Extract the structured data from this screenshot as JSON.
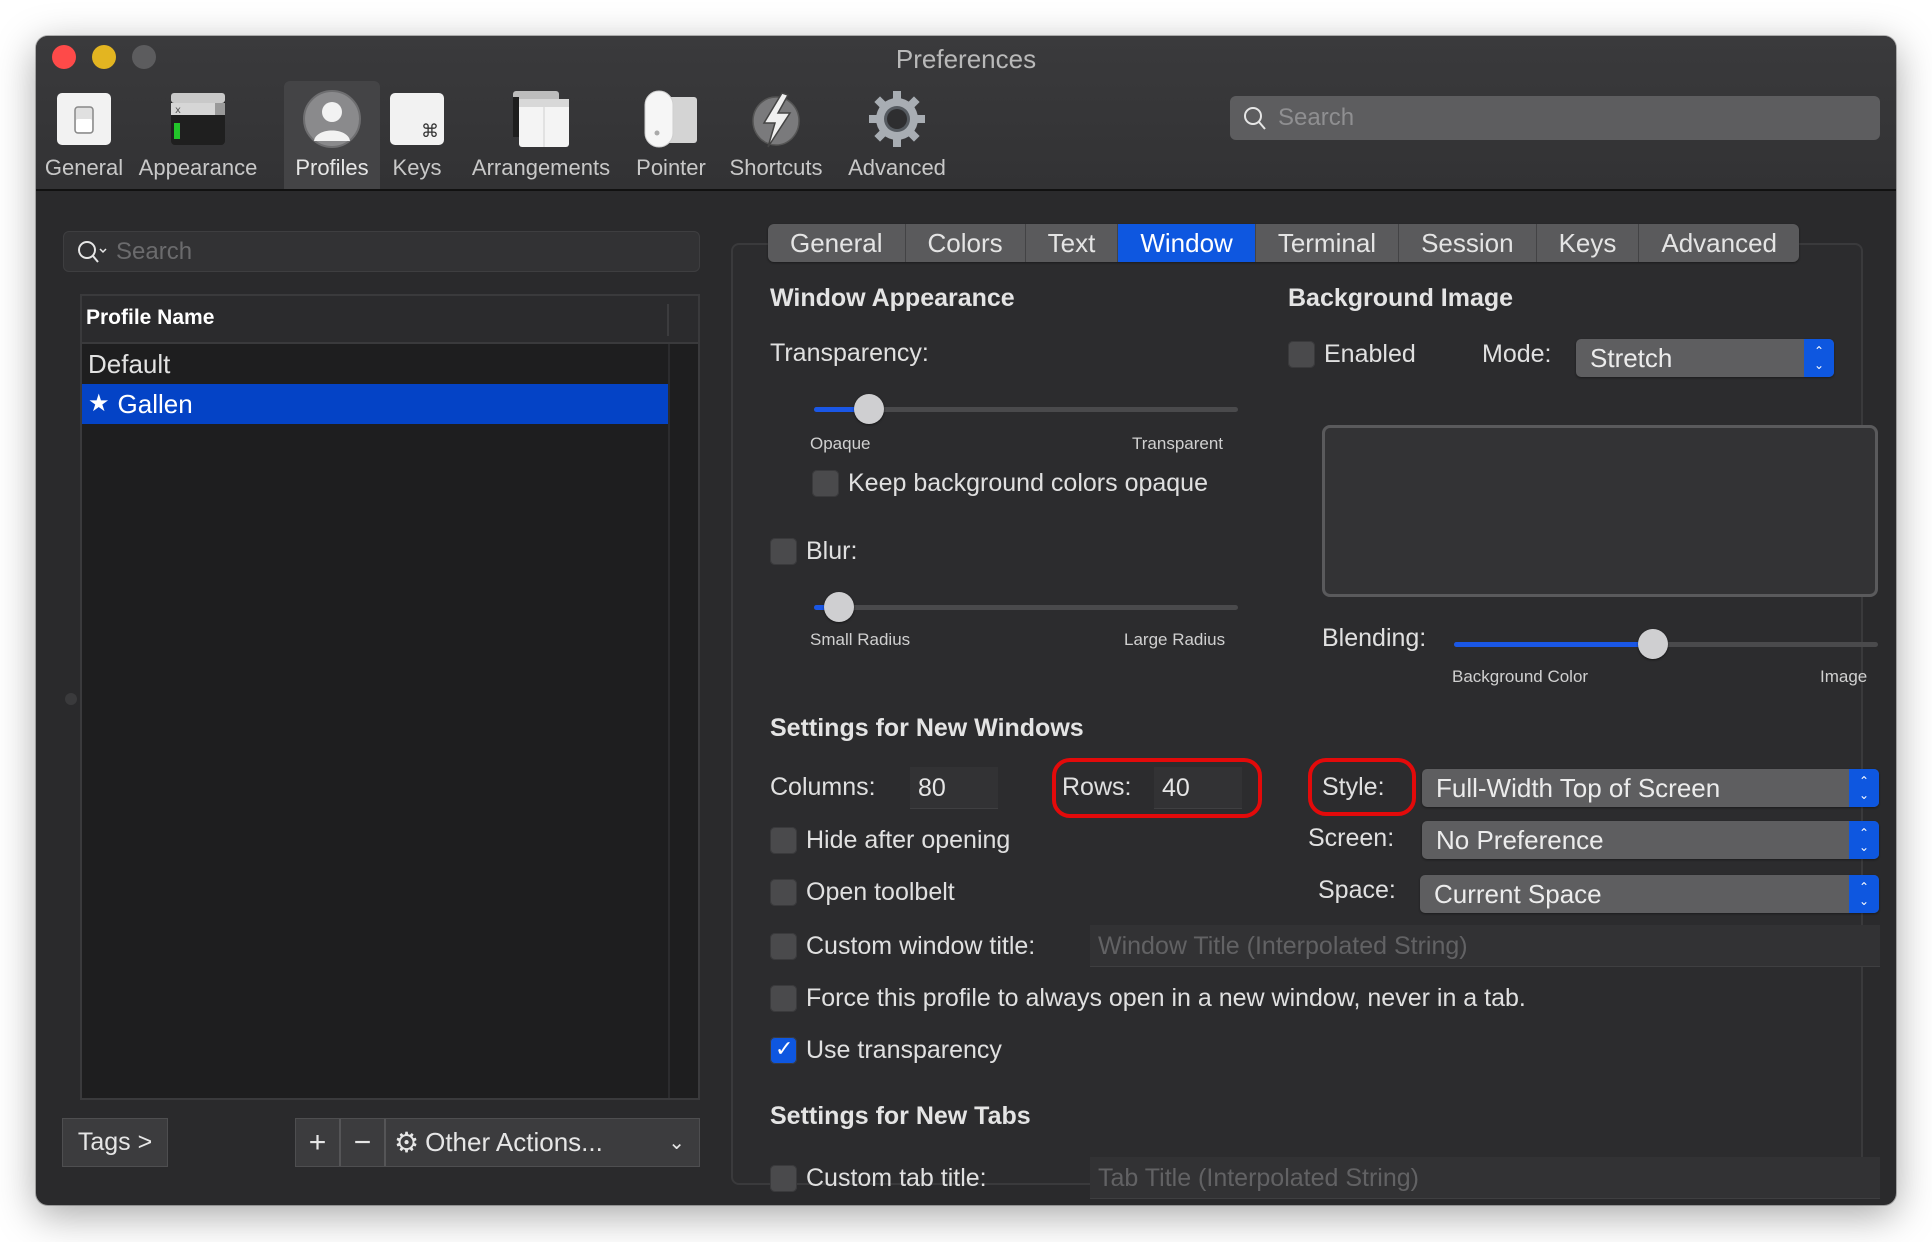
{
  "window": {
    "title": "Preferences",
    "traffic_lights": [
      "close",
      "minimize",
      "zoom"
    ]
  },
  "toolbar": {
    "items": [
      {
        "label": "General",
        "icon": "switch-icon",
        "selected": false
      },
      {
        "label": "Appearance",
        "icon": "appearance-icon",
        "selected": false
      },
      {
        "label": "Profiles",
        "icon": "profile-icon",
        "selected": true
      },
      {
        "label": "Keys",
        "icon": "command-key-icon",
        "selected": false
      },
      {
        "label": "Arrangements",
        "icon": "arrangements-icon",
        "selected": false
      },
      {
        "label": "Pointer",
        "icon": "mouse-icon",
        "selected": false
      },
      {
        "label": "Shortcuts",
        "icon": "lightning-icon",
        "selected": false
      },
      {
        "label": "Advanced",
        "icon": "gear-icon",
        "selected": false
      }
    ],
    "search_placeholder": "Search"
  },
  "sidebar": {
    "search_placeholder": "Search",
    "table_header": "Profile Name",
    "profiles": [
      {
        "name": "Default",
        "selected": false,
        "default_star": false
      },
      {
        "name": "Gallen",
        "selected": true,
        "default_star": true
      }
    ],
    "tags_button": "Tags >",
    "add_button": "+",
    "remove_button": "−",
    "other_actions": "Other Actions..."
  },
  "tabs": {
    "items": [
      "General",
      "Colors",
      "Text",
      "Window",
      "Terminal",
      "Session",
      "Keys",
      "Advanced"
    ],
    "active": "Window"
  },
  "window_appearance": {
    "title": "Window Appearance",
    "transparency_label": "Transparency:",
    "transparency_value": 0.13,
    "transparency_min_label": "Opaque",
    "transparency_max_label": "Transparent",
    "keep_bg_opaque_label": "Keep background colors opaque",
    "keep_bg_opaque": false,
    "blur_label": "Blur:",
    "blur_enabled": false,
    "blur_value": 0.06,
    "blur_min_label": "Small Radius",
    "blur_max_label": "Large Radius"
  },
  "background_image": {
    "title": "Background Image",
    "enabled_label": "Enabled",
    "enabled": false,
    "mode_label": "Mode:",
    "mode_value": "Stretch",
    "blending_label": "Blending:",
    "blending_value": 0.47,
    "blending_min_label": "Background Color",
    "blending_max_label": "Image"
  },
  "new_windows": {
    "title": "Settings for New Windows",
    "columns_label": "Columns:",
    "columns_value": "80",
    "rows_label": "Rows:",
    "rows_value": "40",
    "style_label": "Style:",
    "style_value": "Full-Width Top of Screen",
    "screen_label": "Screen:",
    "screen_value": "No Preference",
    "space_label": "Space:",
    "space_value": "Current Space",
    "hide_after_opening_label": "Hide after opening",
    "hide_after_opening": false,
    "open_toolbelt_label": "Open toolbelt",
    "open_toolbelt": false,
    "custom_window_title_label": "Custom window title:",
    "custom_window_title": false,
    "custom_window_title_placeholder": "Window Title (Interpolated String)",
    "force_new_window_label": "Force this profile to always open in a new window, never in a tab.",
    "force_new_window": false,
    "use_transparency_label": "Use transparency",
    "use_transparency": true
  },
  "new_tabs": {
    "title": "Settings for New Tabs",
    "custom_tab_title_label": "Custom tab title:",
    "custom_tab_title": false,
    "custom_tab_title_placeholder": "Tab Title (Interpolated String)"
  },
  "colors": {
    "accent": "#0e57e0",
    "selection": "#0443c6",
    "annotation": "#e30a0a"
  }
}
